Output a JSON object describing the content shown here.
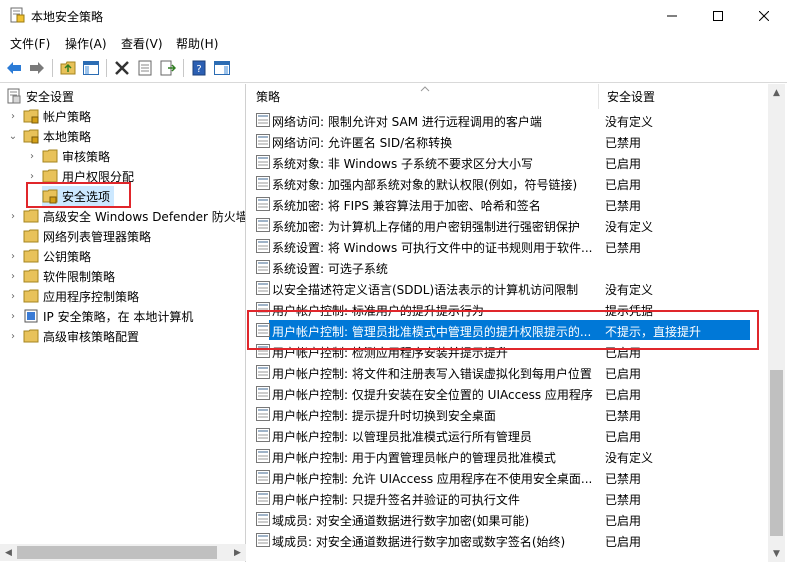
{
  "window": {
    "title": "本地安全策略"
  },
  "menu": [
    "文件(F)",
    "操作(A)",
    "查看(V)",
    "帮助(H)"
  ],
  "tree": [
    {
      "label": "安全设置",
      "level": 0,
      "chev": "",
      "icon": "security-shield"
    },
    {
      "label": "帐户策略",
      "level": 1,
      "chev": "›",
      "icon": "folder"
    },
    {
      "label": "本地策略",
      "level": 1,
      "chev": "⌄",
      "icon": "folder-open"
    },
    {
      "label": "审核策略",
      "level": 2,
      "chev": "›",
      "icon": "folder"
    },
    {
      "label": "用户权限分配",
      "level": 2,
      "chev": "›",
      "icon": "folder"
    },
    {
      "label": "安全选项",
      "level": 2,
      "chev": "",
      "icon": "folder"
    },
    {
      "label": "高级安全 Windows Defender 防火墙",
      "level": 1,
      "chev": "›",
      "icon": "folder"
    },
    {
      "label": "网络列表管理器策略",
      "level": 1,
      "chev": "",
      "icon": "folder"
    },
    {
      "label": "公钥策略",
      "level": 1,
      "chev": "›",
      "icon": "folder"
    },
    {
      "label": "软件限制策略",
      "level": 1,
      "chev": "›",
      "icon": "folder"
    },
    {
      "label": "应用程序控制策略",
      "level": 1,
      "chev": "›",
      "icon": "folder"
    },
    {
      "label": "IP 安全策略，在 本地计算机",
      "level": 1,
      "chev": "›",
      "icon": "ip-policy"
    },
    {
      "label": "高级审核策略配置",
      "level": 1,
      "chev": "›",
      "icon": "folder"
    }
  ],
  "columns": {
    "policy": "策略",
    "setting": "安全设置"
  },
  "policies": [
    {
      "name": "网络访问: 限制允许对 SAM 进行远程调用的客户端",
      "value": "没有定义"
    },
    {
      "name": "网络访问: 允许匿名 SID/名称转换",
      "value": "已禁用"
    },
    {
      "name": "系统对象: 非 Windows 子系统不要求区分大小写",
      "value": "已启用"
    },
    {
      "name": "系统对象: 加强内部系统对象的默认权限(例如，符号链接)",
      "value": "已启用"
    },
    {
      "name": "系统加密: 将 FIPS 兼容算法用于加密、哈希和签名",
      "value": "已禁用"
    },
    {
      "name": "系统加密: 为计算机上存储的用户密钥强制进行强密钥保护",
      "value": "没有定义"
    },
    {
      "name": "系统设置: 将 Windows 可执行文件中的证书规则用于软件...",
      "value": "已禁用"
    },
    {
      "name": "系统设置: 可选子系统",
      "value": ""
    },
    {
      "name": "以安全描述符定义语言(SDDL)语法表示的计算机访问限制",
      "value": "没有定义"
    },
    {
      "name": "用户帐户控制: 标准用户的提升提示行为",
      "value": "提示凭据"
    },
    {
      "name": "用户帐户控制: 管理员批准模式中管理员的提升权限提示的...",
      "value": "不提示，直接提升",
      "selected": true
    },
    {
      "name": "用户帐户控制: 检测应用程序安装并提示提升",
      "value": "已启用"
    },
    {
      "name": "用户帐户控制: 将文件和注册表写入错误虚拟化到每用户位置",
      "value": "已启用"
    },
    {
      "name": "用户帐户控制: 仅提升安装在安全位置的 UIAccess 应用程序",
      "value": "已启用"
    },
    {
      "name": "用户帐户控制: 提示提升时切换到安全桌面",
      "value": "已禁用"
    },
    {
      "name": "用户帐户控制: 以管理员批准模式运行所有管理员",
      "value": "已启用"
    },
    {
      "name": "用户帐户控制: 用于内置管理员帐户的管理员批准模式",
      "value": "没有定义"
    },
    {
      "name": "用户帐户控制: 允许 UIAccess 应用程序在不使用安全桌面...",
      "value": "已禁用"
    },
    {
      "name": "用户帐户控制: 只提升签名并验证的可执行文件",
      "value": "已禁用"
    },
    {
      "name": "域成员: 对安全通道数据进行数字加密(如果可能)",
      "value": "已启用"
    },
    {
      "name": "域成员: 对安全通道数据进行数字加密或数字签名(始终)",
      "value": "已启用"
    }
  ],
  "colors": {
    "selection": "#0078d7",
    "highlight_box": "#e0262b",
    "folder": "#e8c25a"
  }
}
